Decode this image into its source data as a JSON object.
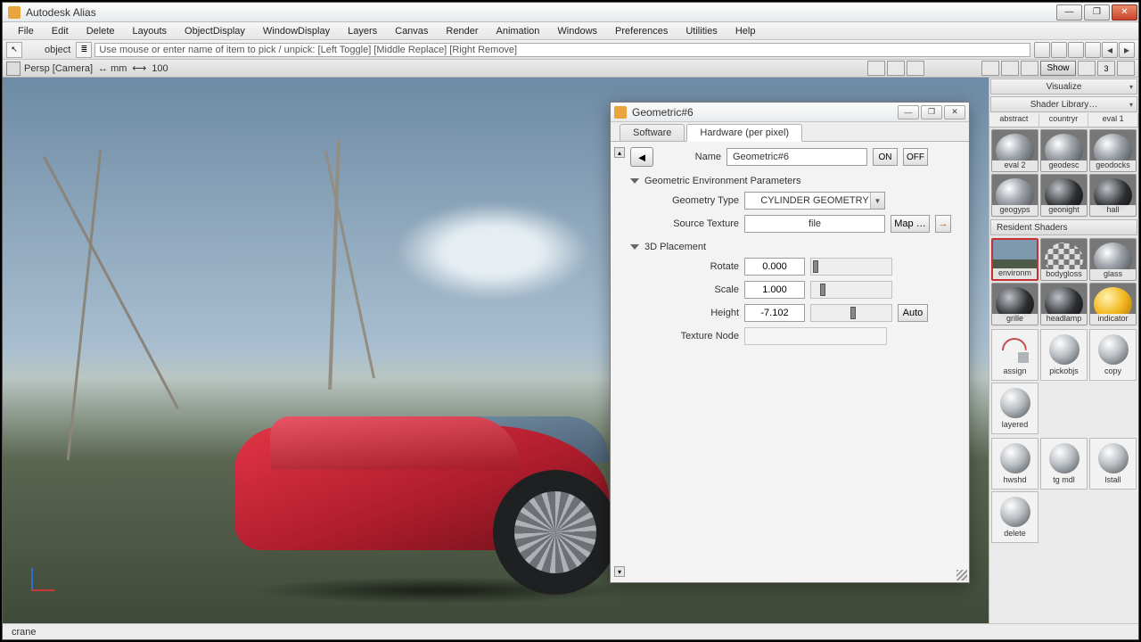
{
  "app": {
    "title": "Autodesk Alias"
  },
  "menu": [
    "File",
    "Edit",
    "Delete",
    "Layouts",
    "ObjectDisplay",
    "WindowDisplay",
    "Layers",
    "Canvas",
    "Render",
    "Animation",
    "Windows",
    "Preferences",
    "Utilities",
    "Help"
  ],
  "toolbar": {
    "object_label": "object",
    "prompt": "Use mouse or enter name of item to pick / unpick: [Left Toggle] [Middle Replace] [Right Remove]"
  },
  "viewbar": {
    "camera": "Persp [Camera]",
    "units": "↔ mm",
    "zoom": "100",
    "show": "Show",
    "three": "3"
  },
  "status": {
    "text": "crane"
  },
  "rightpanel": {
    "visualize": "Visualize",
    "shaderlib": "Shader Library…",
    "lib_tabs": [
      "abstract",
      "countryr",
      "eval 1"
    ],
    "lib_swatches": [
      {
        "label": "eval 2",
        "variant": ""
      },
      {
        "label": "geodesc",
        "variant": ""
      },
      {
        "label": "geodocks",
        "variant": ""
      },
      {
        "label": "geogyps",
        "variant": ""
      },
      {
        "label": "geonight",
        "variant": "dark"
      },
      {
        "label": "hall",
        "variant": "dark"
      }
    ],
    "resident_header": "Resident Shaders",
    "resident": [
      {
        "label": "environm",
        "variant": "env sel"
      },
      {
        "label": "bodygloss",
        "variant": "check"
      },
      {
        "label": "glass",
        "variant": ""
      },
      {
        "label": "grille",
        "variant": "dark"
      },
      {
        "label": "headlamp",
        "variant": "dark"
      },
      {
        "label": "indicator",
        "variant": "yellow"
      }
    ],
    "tools1": [
      {
        "label": "assign",
        "icon": "arr"
      },
      {
        "label": "pickobjs",
        "icon": "ball"
      },
      {
        "label": "copy",
        "icon": "ball"
      },
      {
        "label": "layered",
        "icon": "ball"
      }
    ],
    "tools2": [
      {
        "label": "hwshd",
        "icon": "ball"
      },
      {
        "label": "tg mdl",
        "icon": "ball"
      },
      {
        "label": "lstall",
        "icon": "ball"
      },
      {
        "label": "delete",
        "icon": "ball"
      }
    ]
  },
  "dialog": {
    "title": "Geometric#6",
    "tabs": {
      "software": "Software",
      "hardware": "Hardware (per pixel)"
    },
    "name_label": "Name",
    "name_value": "Geometric#6",
    "on": "ON",
    "off": "OFF",
    "section_env": "Geometric Environment Parameters",
    "geom_type_label": "Geometry Type",
    "geom_type_value": "CYLINDER GEOMETRY",
    "src_tex_label": "Source Texture",
    "src_tex_value": "file",
    "map_btn": "Map …",
    "section_3d": "3D Placement",
    "rotate_label": "Rotate",
    "rotate_value": "0.000",
    "scale_label": "Scale",
    "scale_value": "1.000",
    "height_label": "Height",
    "height_value": "-7.102",
    "auto": "Auto",
    "texnode_label": "Texture Node"
  }
}
